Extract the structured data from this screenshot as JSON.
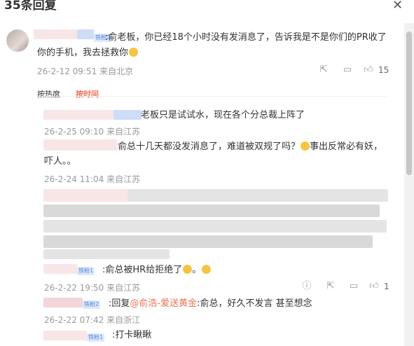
{
  "header": {
    "title": "35条回复",
    "close_icon": "close-icon"
  },
  "main_comment": {
    "badge": "铁粉2",
    "text_line1": ":俞老板，你已经18个小时没有发消息了，告诉我是不是你们的PR收了",
    "text_line2": "你的手机，我去拯救你",
    "time": "26-2-12 09:51",
    "location": "来自北京",
    "likes": "15"
  },
  "sort_tabs": {
    "hot": "按热度",
    "time": "按时间",
    "active_color": "#eb7350"
  },
  "replies": [
    {
      "text": "老板只是试试水，现在各个分总裁上阵了",
      "time": "26-2-25 09:10",
      "location": "来自江苏"
    },
    {
      "text_line1": "俞总十几天都没发消息了，难道被双规了吗？",
      "text_line1b": "事出反常必有妖，",
      "text_line2": "吓人。。",
      "time": "26-2-24 11:04",
      "location": "来自江苏"
    },
    {
      "badge": "铁粉1",
      "text": ":俞总被HR给拒绝了",
      "text_tail": "。",
      "time": "26-2-22 19:50",
      "location": "来自江苏",
      "likes": "1"
    },
    {
      "badge": "铁粉2",
      "prefix": ":回复",
      "mention": "@俞浩-爱送黄金",
      "text": ":俞总，好久不发言 甚至想念",
      "time": "26-2-22 07:42",
      "location": "来自浙江"
    },
    {
      "badge": "铁粉1",
      "text": ":打卡瞅瞅"
    }
  ]
}
